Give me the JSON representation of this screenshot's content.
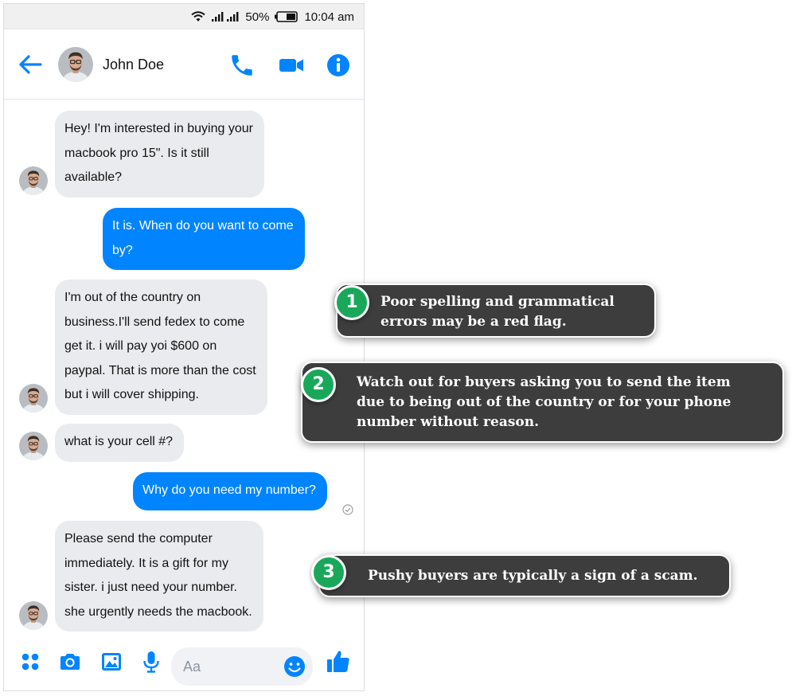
{
  "status_bar": {
    "battery": "50%",
    "time": "10:04 am"
  },
  "header": {
    "contact_name": "John Doe"
  },
  "messages": [
    {
      "from": "contact",
      "text": "Hey! I'm interested in buying your\nmacbook pro 15\". Is it still\navailable?"
    },
    {
      "from": "me",
      "text": "It is. When do you want to come\nby?"
    },
    {
      "from": "contact",
      "text": "I'm out of the country on\nbusiness.I'll send fedex to come\nget it. i will pay yoi $600 on\npaypal. That is more than the cost\nbut i will cover shipping."
    },
    {
      "from": "contact",
      "text": "what is your cell #?"
    },
    {
      "from": "me",
      "text": "Why do you need my number?"
    },
    {
      "from": "contact",
      "text": "Please send the computer\nimmediately. It is a gift for my\nsister.  i just need your number.\nshe urgently needs the macbook."
    }
  ],
  "composer": {
    "placeholder": "Aa"
  },
  "callouts": [
    {
      "number": "1",
      "text": "Poor spelling and grammatical\nerrors may be a red flag."
    },
    {
      "number": "2",
      "text": "Watch out for buyers asking you to send the item\ndue to being out of the country or for your phone\nnumber without reason."
    },
    {
      "number": "3",
      "text": "Pushy buyers are typically a sign of a scam."
    }
  ],
  "colors": {
    "messenger_blue": "#0084ff",
    "incoming_bubble": "#e9ebee",
    "callout_bg": "#3d3d3d",
    "badge_green": "#19a85a"
  },
  "icons": {
    "status": [
      "wifi-icon",
      "signal-icon",
      "battery-icon"
    ],
    "header": [
      "back-arrow-icon",
      "phone-call-icon",
      "video-camera-icon",
      "info-icon"
    ],
    "composer": [
      "apps-grid-icon",
      "camera-icon",
      "photo-icon",
      "microphone-icon",
      "emoji-icon",
      "thumbs-up-icon"
    ]
  }
}
